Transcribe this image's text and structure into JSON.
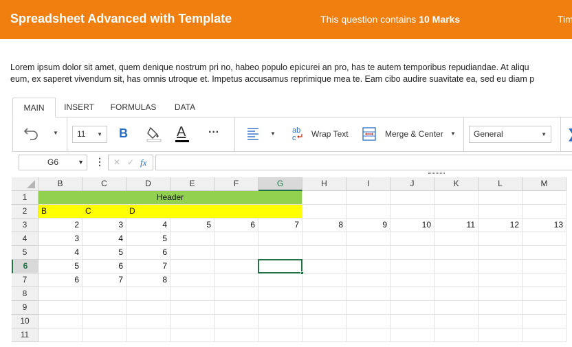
{
  "header": {
    "title": "Spreadsheet Advanced with Template",
    "marks_prefix": "This question contains ",
    "marks_value": "10 Marks",
    "timer_label": "Tim"
  },
  "description": {
    "line1": "Lorem ipsum dolor sit amet, quem denique nostrum pri no, habeo populo epicurei an pro, has te autem temporibus repudiandae. At aliqu",
    "line2": "eum, ex saperet vivendum sit, has omnis utroque et. Impetus accusamus reprimique mea te. Eam cibo audire suavitate ea, sed eu diam p"
  },
  "ribbon": {
    "tabs": [
      "MAIN",
      "INSERT",
      "FORMULAS",
      "DATA"
    ],
    "font_size": "11",
    "bold_label": "B",
    "font_color_label": "A",
    "more_label": "···",
    "wrap_text_label": "Wrap Text",
    "merge_center_label": "Merge & Center",
    "number_format": "General",
    "colors": {
      "accent": "#f07f10",
      "select": "#217346",
      "header_fill": "#92d050",
      "yellow_fill": "#ffff00",
      "blue_icon": "#2b6cc4"
    }
  },
  "formula_bar": {
    "name_box": "G6",
    "fx_label": "fx",
    "cancel_glyph": "✕",
    "confirm_glyph": "✓",
    "value": ""
  },
  "sheet": {
    "columns": [
      "B",
      "C",
      "D",
      "E",
      "F",
      "G",
      "H",
      "I",
      "J",
      "K",
      "L",
      "M"
    ],
    "rows": [
      "1",
      "2",
      "3",
      "4",
      "5",
      "6",
      "7",
      "8",
      "9",
      "10",
      "11"
    ],
    "selected_cell": "G6",
    "merged_header": "Header",
    "row2": [
      "B",
      "C",
      "D"
    ],
    "row3": [
      "2",
      "3",
      "4",
      "5",
      "6",
      "7",
      "8",
      "9",
      "10",
      "11",
      "12",
      "13"
    ],
    "row4": [
      "3",
      "4",
      "5"
    ],
    "row5": [
      "4",
      "5",
      "6"
    ],
    "row6": [
      "5",
      "6",
      "7"
    ],
    "row7": [
      "6",
      "7",
      "8"
    ]
  }
}
